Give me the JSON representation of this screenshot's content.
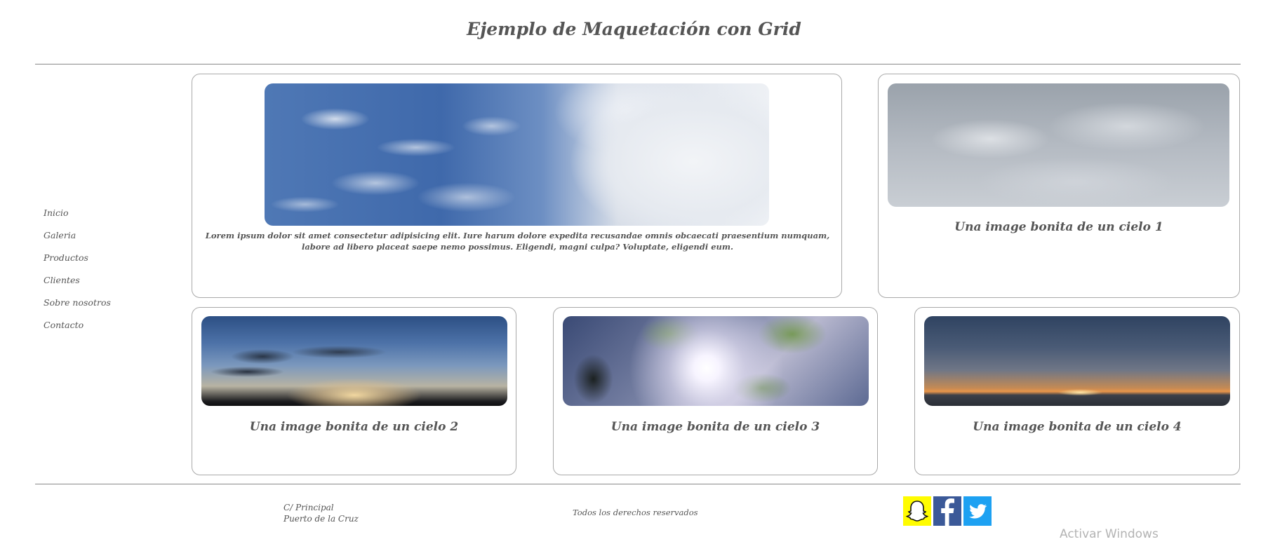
{
  "header": {
    "title": "Ejemplo de Maquetación con Grid"
  },
  "sidebar": {
    "items": [
      {
        "label": "Inicio"
      },
      {
        "label": "Galeria"
      },
      {
        "label": "Productos"
      },
      {
        "label": "Clientes"
      },
      {
        "label": "Sobre nosotros"
      },
      {
        "label": "Contacto"
      }
    ]
  },
  "main": {
    "feature": {
      "image": "sky-blue-clouds-image",
      "text": "Lorem ipsum dolor sit amet consectetur adipisicing elit. Iure harum dolore expedita recusandae omnis obcaecati praesentium numquam, labore ad libero placeat saepe nemo possimus. Eligendi, magni culpa? Voluptate, eligendi eum."
    },
    "cards": [
      {
        "caption": "Una image bonita de un cielo 1",
        "image": "overcast-sky-image"
      },
      {
        "caption": "Una image bonita de un cielo 2",
        "image": "sunset-clouds-image"
      },
      {
        "caption": "Una image bonita de un cielo 3",
        "image": "tree-sun-image"
      },
      {
        "caption": "Una image bonita de un cielo 4",
        "image": "sea-sunset-image"
      }
    ]
  },
  "footer": {
    "address_line1": "C/ Principal",
    "address_line2": "Puerto de la Cruz",
    "rights": "Todos los derechos reservados",
    "social": [
      {
        "icon": "snapchat-icon",
        "color": "#fffc00"
      },
      {
        "icon": "facebook-icon",
        "color": "#3b5998"
      },
      {
        "icon": "twitter-icon",
        "color": "#1da1f2"
      }
    ]
  },
  "overlay": {
    "watermark": "Activar Windows"
  }
}
